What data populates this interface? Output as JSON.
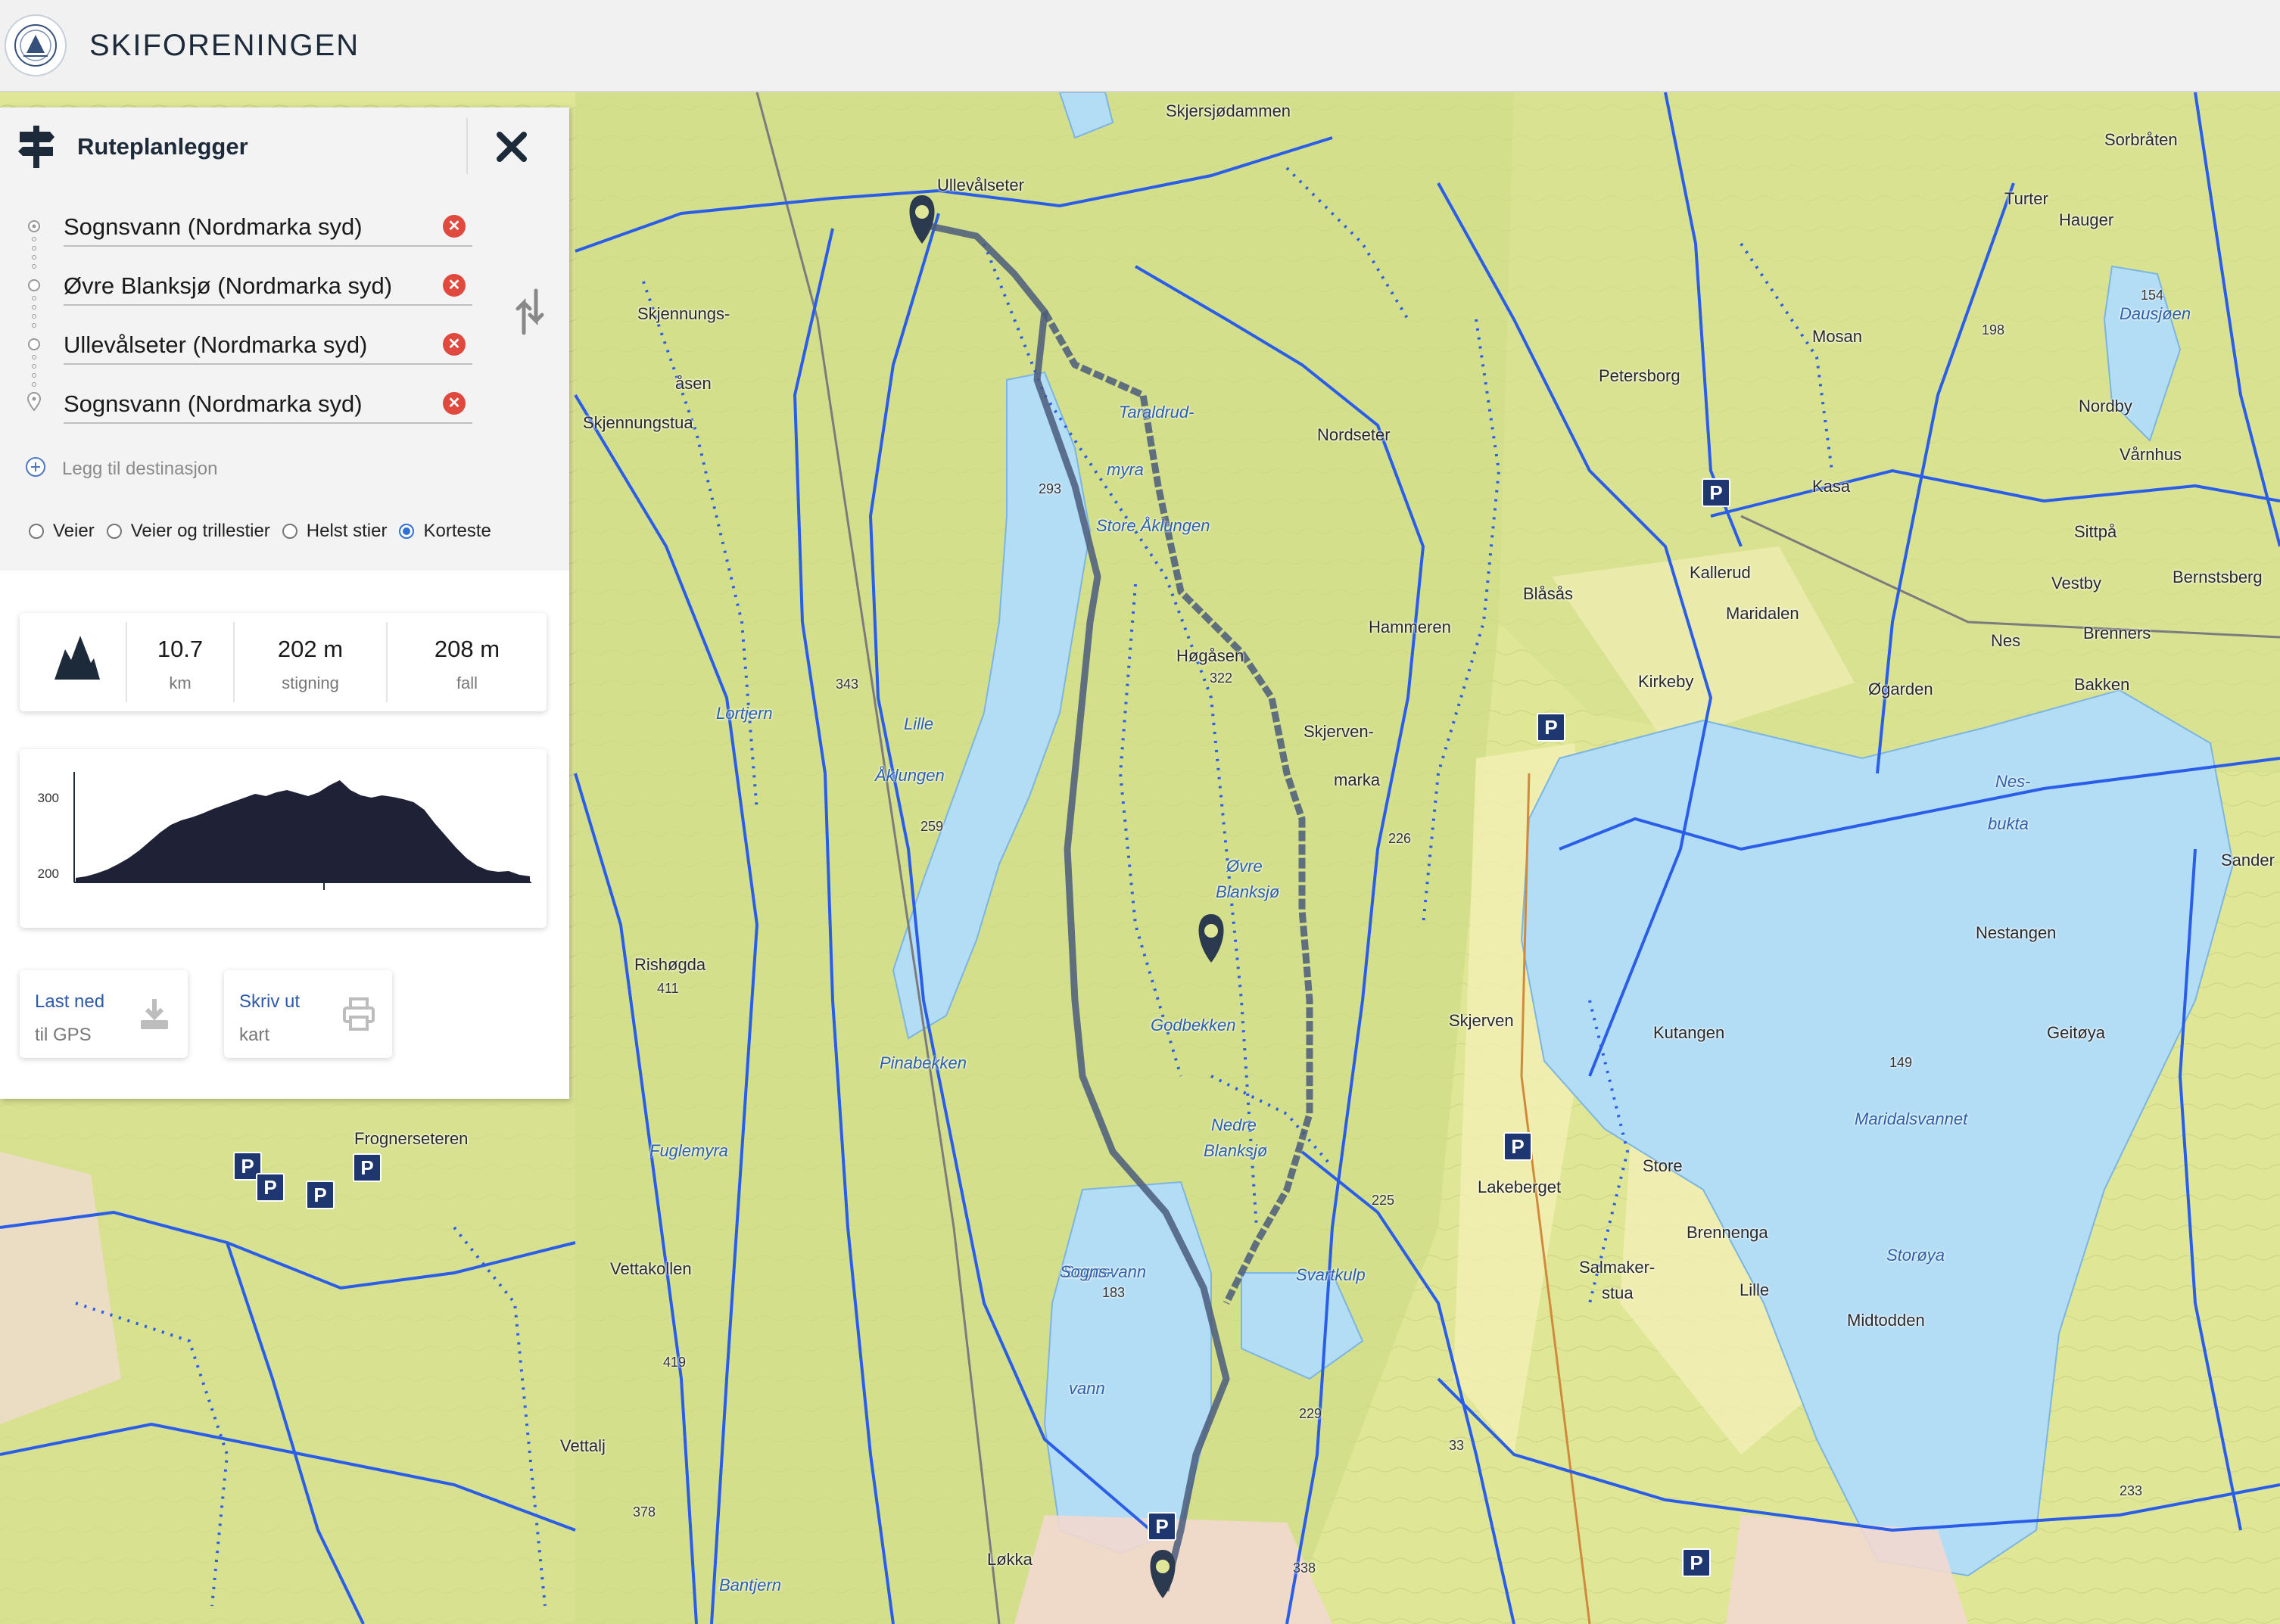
{
  "header": {
    "brand": "SKIFORENINGEN",
    "logo_icon": "skiforeningen-logo"
  },
  "panel": {
    "title": "Ruteplanlegger",
    "title_icon": "signpost-icon",
    "close_icon": "close-icon",
    "destinations": [
      {
        "value": "Sognsvann (Nordmarka syd)",
        "marker": "start-circle-icon"
      },
      {
        "value": "Øvre Blanksjø (Nordmarka syd)",
        "marker": "waypoint-circle-icon"
      },
      {
        "value": "Ullevålseter (Nordmarka syd)",
        "marker": "waypoint-circle-icon"
      },
      {
        "value": "Sognsvann (Nordmarka syd)",
        "marker": "end-pin-icon"
      }
    ],
    "add_destination": "Legg til destinasjon",
    "route_types": [
      {
        "label": "Veier",
        "selected": false
      },
      {
        "label": "Veier og trillestier",
        "selected": false
      },
      {
        "label": "Helst stier",
        "selected": false
      },
      {
        "label": "Korteste",
        "selected": true
      }
    ],
    "stats": {
      "distance_value": "10.7",
      "distance_unit": "km",
      "climb_value": "202 m",
      "climb_unit": "stigning",
      "descent_value": "208 m",
      "descent_unit": "fall"
    },
    "profile": {
      "ytick_300": "300",
      "ytick_200": "200",
      "elevation": [
        196,
        198,
        202,
        207,
        214,
        222,
        232,
        244,
        256,
        266,
        272,
        276,
        281,
        287,
        292,
        297,
        302,
        307,
        304,
        309,
        312,
        308,
        304,
        309,
        318,
        325,
        312,
        305,
        302,
        305,
        303,
        300,
        296,
        286,
        268,
        252,
        236,
        222,
        212,
        206,
        204,
        205,
        200,
        198
      ]
    },
    "actions": {
      "download_title": "Last ned",
      "download_sub": "til GPS",
      "print_title": "Skriv ut",
      "print_sub": "kart"
    }
  },
  "map": {
    "places": [
      "Skjersjødammen",
      "Ullevålseter",
      "Sorbråten",
      "Turter",
      "Hauger",
      "Dausjøen",
      "Skjennungs-",
      "åsen",
      "Skjennungstua",
      "Taraldrud-",
      "myra",
      "Store Åklungen",
      "Nordseter",
      "Petersborg",
      "Mosan",
      "Nordby",
      "Kasa",
      "Vårnhus",
      "Sittpå",
      "Kallerud",
      "Maridalen",
      "Vestby",
      "Bernstsberg",
      "Blåsås",
      "Hammeren",
      "Brenners",
      "Nes",
      "Kirkeby",
      "Øgarden",
      "Bakken",
      "Høgåsen",
      "Lortjern",
      "Lille",
      "Åklungen",
      "Skjerven-",
      "marka",
      "Øvre",
      "Blanksjø",
      "Nes-",
      "bukta",
      "Nestangen",
      "Kutangen",
      "Geitøya",
      "Maridalsvannet",
      "Storøya",
      "Midtodden",
      "Store",
      "Brennenga",
      "Lille",
      "Salmaker-",
      "stua",
      "Skjerven",
      "Lakeberget",
      "Rishøgda",
      "Fuglemyra",
      "Frognerseteren",
      "Vettakollen",
      "Vettalj",
      "Sognsvann",
      "Nedre",
      "Blanksjø",
      "Svartkulp",
      "Sogns-",
      "vann",
      "Løkka",
      "Bantjern",
      "Sander",
      "Pinabekken",
      "Godbekken"
    ],
    "spot_heights": [
      "293",
      "343",
      "322",
      "259",
      "226",
      "411",
      "419",
      "378",
      "225",
      "183",
      "229",
      "149",
      "154",
      "198",
      "233",
      "338",
      "33"
    ],
    "route_color": "#4a5c7a",
    "trail_color": "#2b5ee8",
    "lake_color": "#b3dcf5"
  }
}
